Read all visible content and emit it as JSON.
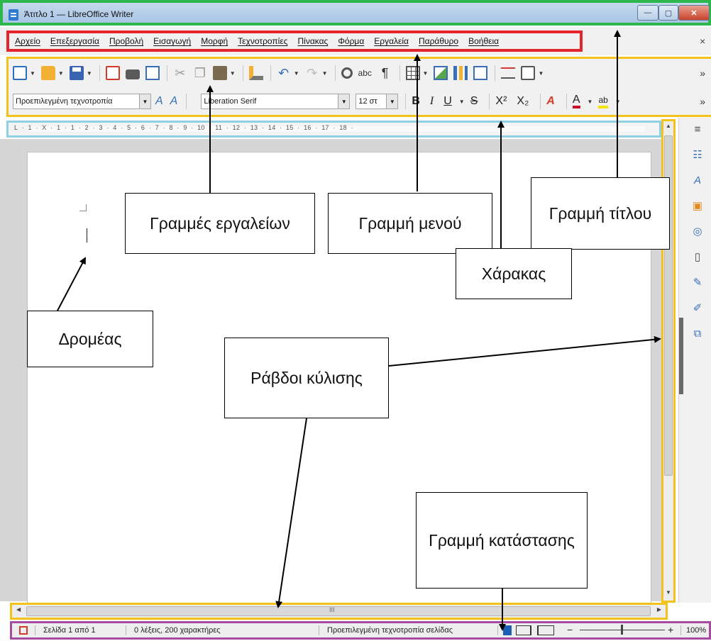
{
  "window": {
    "title": "Άτιτλο 1 — LibreOffice Writer",
    "minimize": "—",
    "maximize": "▢",
    "close": "✕"
  },
  "menu": {
    "items": [
      "Αρχείο",
      "Επεξεργασία",
      "Προβολή",
      "Εισαγωγή",
      "Μορφή",
      "Τεχνοτροπίες",
      "Πίνακας",
      "Φόρμα",
      "Εργαλεία",
      "Παράθυρο",
      "Βοήθεια"
    ],
    "close_document": "×"
  },
  "toolbar": {
    "paragraph_style": "Προεπιλεγμένη τεχνοτροπία",
    "font_name": "Liberation Serif",
    "font_size": "12 στ",
    "bold": "B",
    "italic": "I",
    "underline": "U",
    "strikethrough": "S",
    "superscript": "X²",
    "subscript": "X₂",
    "font_color": "A",
    "highlight": "ab",
    "overflow": "»",
    "spell_label": "abc",
    "pilcrow": "¶"
  },
  "ruler": {
    "ticks": "L  ·  1  ·  X  ·  1  ·  1  ·  2  ·  3  ·  4  ·  5  ·  6  ·  7  ·  8  ·  9  ·  10  ·  11  ·  12  ·  13  ·  14  ·  15  ·  16  ·  17  ·  18  ·"
  },
  "statusbar": {
    "page": "Σελίδα 1 από 1",
    "words": "0 λέξεις, 200 χαρακτήρες",
    "page_style": "Προεπιλεγμένη τεχνοτροπία σελίδας",
    "zoom_minus": "−",
    "zoom_plus": "+",
    "zoom": "100%"
  },
  "scrollbars": {
    "grip": "III"
  },
  "sidebar": {
    "icons": [
      "menu-icon",
      "properties-icon",
      "styles-icon",
      "gallery-icon",
      "navigator-icon",
      "page-icon",
      "style-inspector-icon",
      "manage-changes-icon",
      "design-icon"
    ]
  },
  "annotations": {
    "toolbars": "Γραμμές εργαλείων",
    "menubar": "Γραμμή μενού",
    "titlebar": "Γραμμή τίτλου",
    "ruler": "Χάρακας",
    "cursor": "Δρομέας",
    "scrollbars": "Ράβδοι κύλισης",
    "statusbar": "Γραμμή κατάστασης"
  },
  "colors": {
    "titlebar_outline": "#2db84d",
    "menubar_outline": "#e4262c",
    "toolbar_outline": "#f3c21b",
    "ruler_outline": "#8fd1e3",
    "statusbar_outline": "#a64aa2"
  }
}
